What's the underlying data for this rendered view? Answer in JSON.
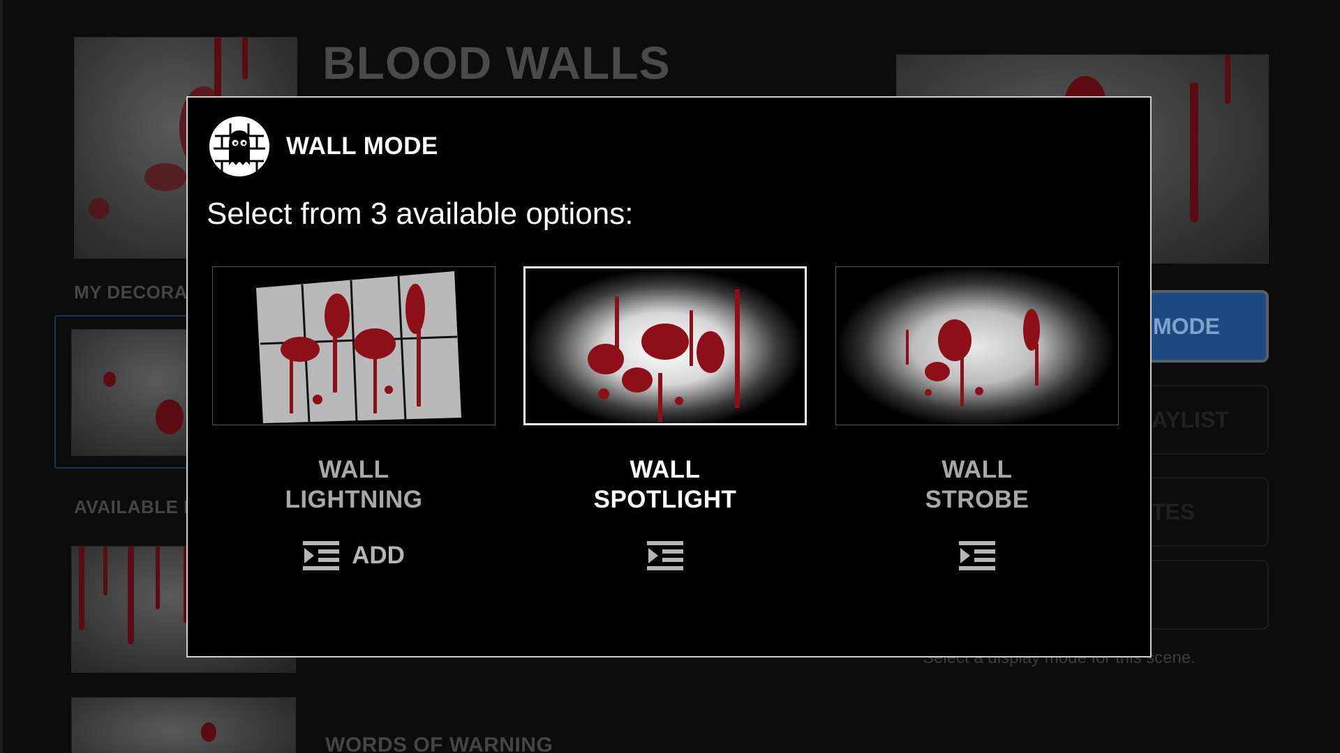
{
  "background": {
    "title": "BLOOD WALLS",
    "sections": {
      "my_decorations": "MY DECORA",
      "available": "AVAILABLE F",
      "warning": "WORDS OF WARNING"
    },
    "side_buttons": [
      "MODE",
      "AYLIST",
      "TES",
      ""
    ],
    "hint": "Select a display mode for this scene."
  },
  "modal": {
    "title": "WALL MODE",
    "logo_icon": "ghost-wall-icon",
    "prompt": "Select from 3 available options:",
    "options": [
      {
        "line1": "WALL",
        "line2": "LIGHTNING",
        "action": "ADD",
        "icon": "add-to-queue-icon",
        "selected": false
      },
      {
        "line1": "WALL",
        "line2": "SPOTLIGHT",
        "action": "",
        "icon": "add-to-queue-icon",
        "selected": true
      },
      {
        "line1": "WALL",
        "line2": "STROBE",
        "action": "",
        "icon": "add-to-queue-icon",
        "selected": false
      }
    ]
  },
  "colors": {
    "blood": "#8c0f1a",
    "primary_button": "#1d4a80",
    "modal_border": "#cfcfcf"
  }
}
